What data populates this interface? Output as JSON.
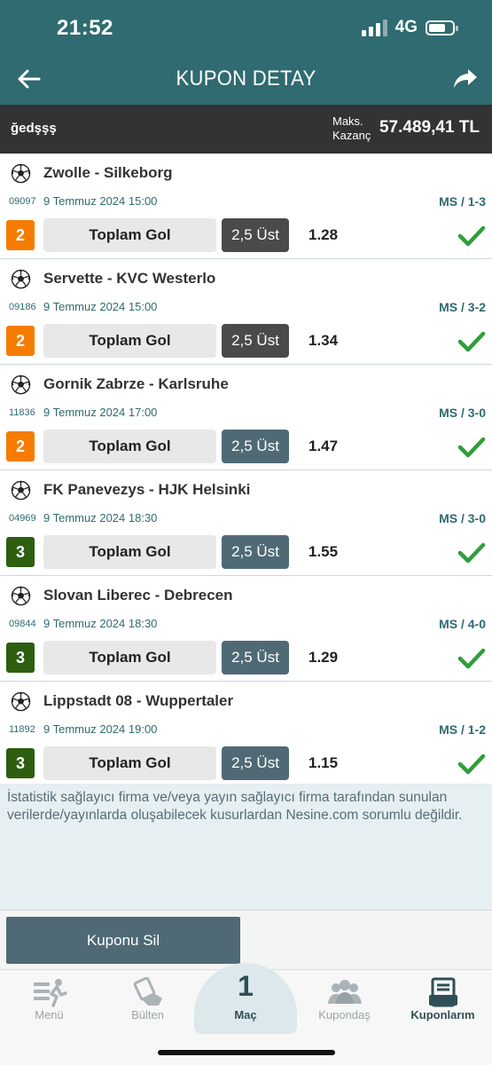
{
  "status_bar": {
    "time": "21:52",
    "network": "4G"
  },
  "header": {
    "title": "KUPON DETAY"
  },
  "summary": {
    "name": "ğedşşş",
    "max_label": "Maks. Kazanç",
    "max_value": "57.489,41 TL"
  },
  "colors": {
    "primary": "#2f6b70",
    "orange": "#f57c00",
    "green": "#2e5e10",
    "check": "#2e9e3a",
    "selection_dark": "#4a4a4a",
    "selection_teal": "#4f6a75"
  },
  "matches": [
    {
      "teams": "Zwolle - Silkeborg",
      "code": "09097",
      "date": "9 Temmuz 2024 15:00",
      "result": "MS / 1-3",
      "mbs": "2",
      "mbs_color": "orange",
      "market": "Toplam Gol",
      "selection": "2,5 Üst",
      "selection_style": "dark",
      "odd": "1.28"
    },
    {
      "teams": "Servette - KVC Westerlo",
      "code": "09186",
      "date": "9 Temmuz 2024 15:00",
      "result": "MS / 3-2",
      "mbs": "2",
      "mbs_color": "orange",
      "market": "Toplam Gol",
      "selection": "2,5 Üst",
      "selection_style": "dark",
      "odd": "1.34"
    },
    {
      "teams": "Gornik Zabrze - Karlsruhe",
      "code": "11836",
      "date": "9 Temmuz 2024 17:00",
      "result": "MS / 3-0",
      "mbs": "2",
      "mbs_color": "orange",
      "market": "Toplam Gol",
      "selection": "2,5 Üst",
      "selection_style": "teal",
      "odd": "1.47"
    },
    {
      "teams": "FK Panevezys - HJK Helsinki",
      "code": "04969",
      "date": "9 Temmuz 2024 18:30",
      "result": "MS / 3-0",
      "mbs": "3",
      "mbs_color": "green",
      "market": "Toplam Gol",
      "selection": "2,5 Üst",
      "selection_style": "teal",
      "odd": "1.55"
    },
    {
      "teams": "Slovan Liberec - Debrecen",
      "code": "09844",
      "date": "9 Temmuz 2024 18:30",
      "result": "MS / 4-0",
      "mbs": "3",
      "mbs_color": "green",
      "market": "Toplam Gol",
      "selection": "2,5 Üst",
      "selection_style": "teal",
      "odd": "1.29"
    },
    {
      "teams": "Lippstadt 08 - Wuppertaler",
      "code": "11892",
      "date": "9 Temmuz 2024 19:00",
      "result": "MS / 1-2",
      "mbs": "3",
      "mbs_color": "green",
      "market": "Toplam Gol",
      "selection": "2,5 Üst",
      "selection_style": "teal",
      "odd": "1.15"
    }
  ],
  "disclaimer": "İstatistik sağlayıcı firma ve/veya yayın sağlayıcı firma tarafından sunulan verilerde/yayınlarda oluşabilecek kusurlardan Nesine.com sorumlu değildir.",
  "actions": {
    "delete_label": "Kuponu Sil"
  },
  "tabs": {
    "menu": "Menü",
    "bulten": "Bülten",
    "mac_count": "1",
    "mac": "Maç",
    "kupondas": "Kupondaş",
    "kuponlarim": "Kuponlarım"
  }
}
